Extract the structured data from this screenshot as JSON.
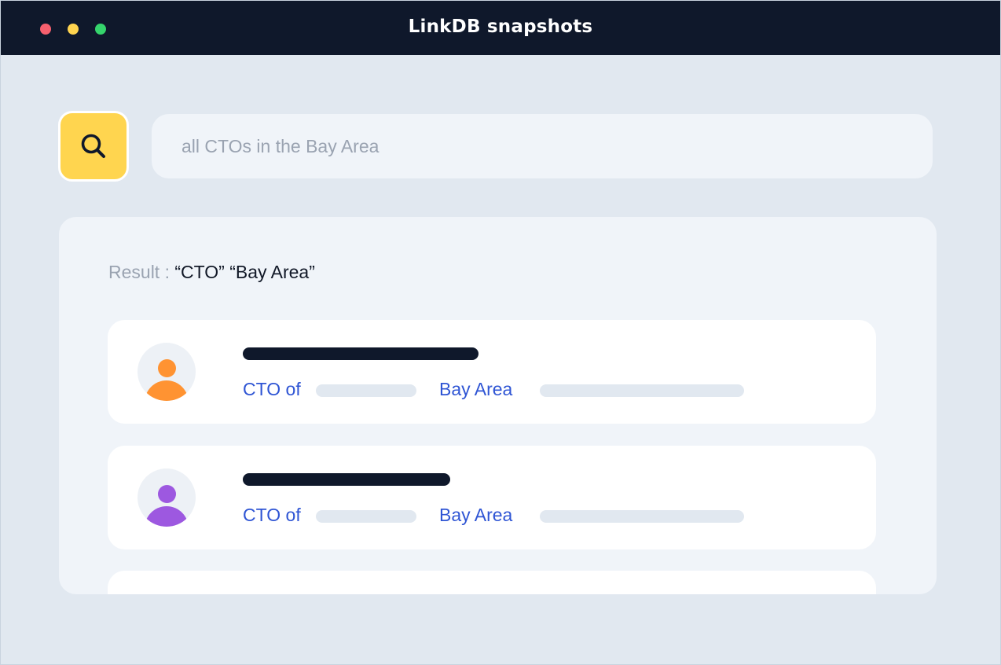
{
  "window": {
    "title": "LinkDB snapshots",
    "controls": [
      "close",
      "minimize",
      "maximize"
    ]
  },
  "search": {
    "icon": "search-icon",
    "placeholder": "all CTOs in the Bay Area",
    "value": ""
  },
  "results": {
    "label": "Result : ",
    "query": "“CTO” “Bay Area”",
    "items": [
      {
        "avatar_color": "#ff9332",
        "role_label": "CTO of",
        "location_label": "Bay Area"
      },
      {
        "avatar_color": "#9d58e0",
        "role_label": "CTO of",
        "location_label": "Bay Area"
      }
    ]
  },
  "colors": {
    "titlebar": "#0f182b",
    "search_button": "#ffd54f",
    "link_text": "#2f55d4",
    "background": "#e1e8f0"
  }
}
